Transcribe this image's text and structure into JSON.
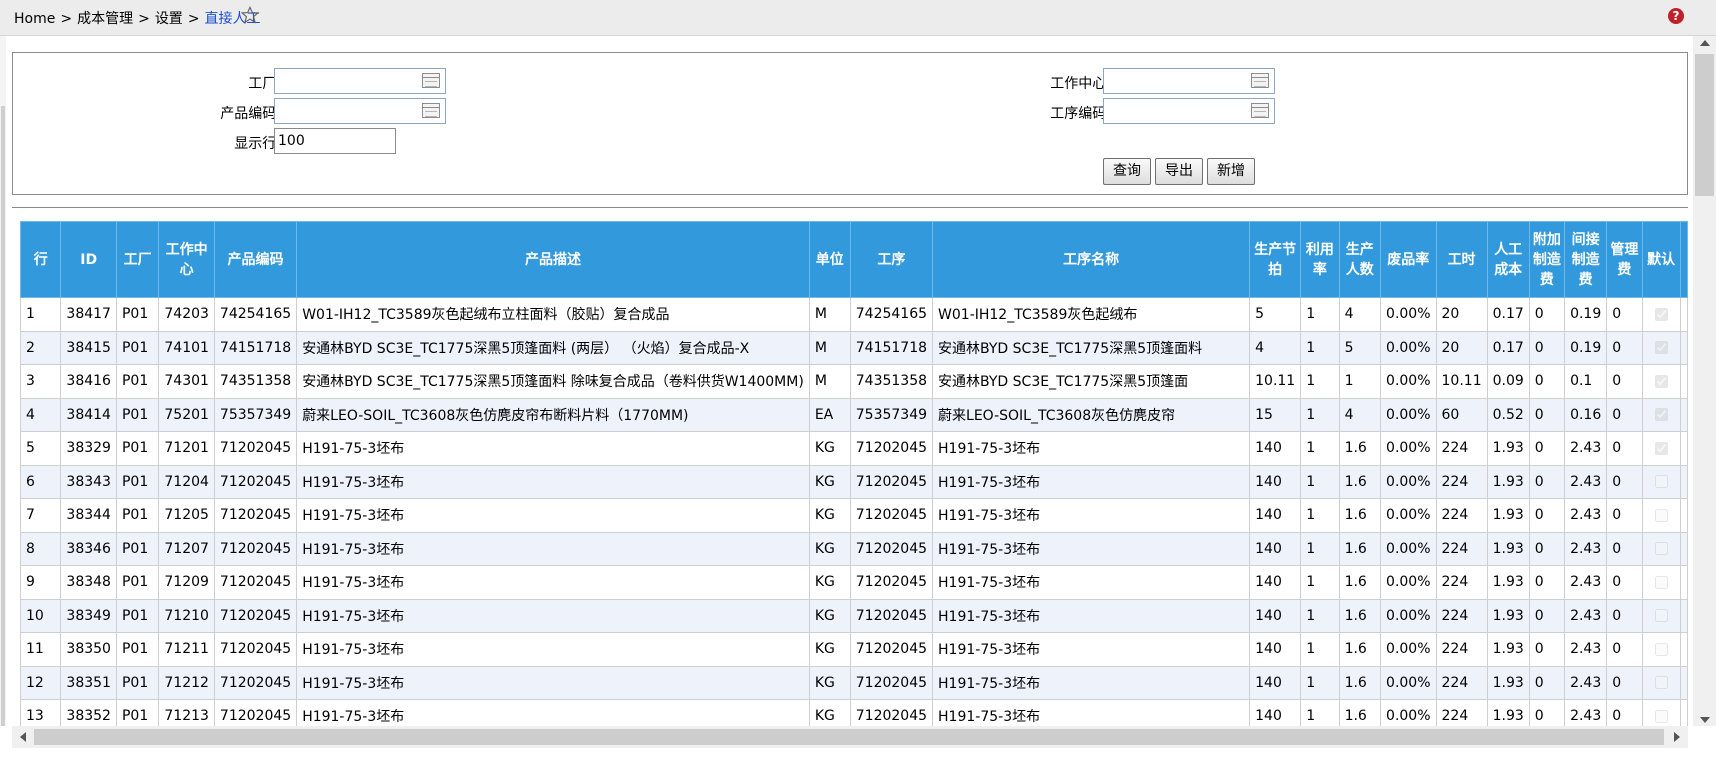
{
  "breadcrumb": {
    "home": "Home",
    "sep": ">",
    "level1": "成本管理",
    "level2": "设置",
    "current": "直接人工"
  },
  "icons": {
    "star": "star-outline-icon",
    "help": "help-icon",
    "picker": "table-picker-icon"
  },
  "help_glyph": "?",
  "filters": {
    "plant_label": "工厂:",
    "product_code_label": "产品编码:",
    "rows_label": "显示行:",
    "rows_value": "100",
    "work_center_label": "工作中心:",
    "process_code_label": "工序编码:",
    "plant_value": "",
    "product_code_value": "",
    "work_center_value": "",
    "process_code_value": ""
  },
  "buttons": {
    "query": "查询",
    "export": "导出",
    "add": "新增"
  },
  "colors": {
    "header_bg": "#3399dd",
    "alt_row_bg": "#eef3fb",
    "link": "#1a4fd6"
  },
  "table": {
    "columns": [
      "行",
      "ID",
      "工厂",
      "工作中心",
      "产品编码",
      "产品描述",
      "单位",
      "工序",
      "工序名称",
      "生产节拍",
      "利用率",
      "生产人数",
      "废品率",
      "工时",
      "人工成本",
      "附加制造费",
      "间接制造费",
      "管理费",
      "默认"
    ],
    "rows": [
      {
        "row": "1",
        "id": "38417",
        "plant": "P01",
        "wc": "74203",
        "code": "74254165",
        "desc": "W01-IH12_TC3589灰色起绒布立柱面料（胶贴）复合成品",
        "unit": "M",
        "proc": "74254165",
        "pname": "W01-IH12_TC3589灰色起绒布",
        "takt": "5",
        "util": "1",
        "workers": "4",
        "scrap": "0.00%",
        "hours": "20",
        "labor": "0.17",
        "addl": "0",
        "indirect": "0.19",
        "mgmt": "0",
        "def": true
      },
      {
        "row": "2",
        "id": "38415",
        "plant": "P01",
        "wc": "74101",
        "code": "74151718",
        "desc": "安通林BYD SC3E_TC1775深黑5顶篷面料 (两层） （火焰）复合成品-X",
        "unit": "M",
        "proc": "74151718",
        "pname": "安通林BYD SC3E_TC1775深黑5顶篷面料",
        "takt": "4",
        "util": "1",
        "workers": "5",
        "scrap": "0.00%",
        "hours": "20",
        "labor": "0.17",
        "addl": "0",
        "indirect": "0.19",
        "mgmt": "0",
        "def": true
      },
      {
        "row": "3",
        "id": "38416",
        "plant": "P01",
        "wc": "74301",
        "code": "74351358",
        "desc": "安通林BYD SC3E_TC1775深黑5顶篷面料 除味复合成品（卷料供货W1400MM)",
        "unit": "M",
        "proc": "74351358",
        "pname": "安通林BYD SC3E_TC1775深黑5顶篷面",
        "takt": "10.11",
        "util": "1",
        "workers": "1",
        "scrap": "0.00%",
        "hours": "10.11",
        "labor": "0.09",
        "addl": "0",
        "indirect": "0.1",
        "mgmt": "0",
        "def": true
      },
      {
        "row": "4",
        "id": "38414",
        "plant": "P01",
        "wc": "75201",
        "code": "75357349",
        "desc": "蔚来LEO-SOIL_TC3608灰色仿麂皮帘布断料片料（1770MM)",
        "unit": "EA",
        "proc": "75357349",
        "pname": "蔚来LEO-SOIL_TC3608灰色仿麂皮帘",
        "takt": "15",
        "util": "1",
        "workers": "4",
        "scrap": "0.00%",
        "hours": "60",
        "labor": "0.52",
        "addl": "0",
        "indirect": "0.16",
        "mgmt": "0",
        "def": true
      },
      {
        "row": "5",
        "id": "38329",
        "plant": "P01",
        "wc": "71201",
        "code": "71202045",
        "desc": "H191-75-3坯布",
        "unit": "KG",
        "proc": "71202045",
        "pname": "H191-75-3坯布",
        "takt": "140",
        "util": "1",
        "workers": "1.6",
        "scrap": "0.00%",
        "hours": "224",
        "labor": "1.93",
        "addl": "0",
        "indirect": "2.43",
        "mgmt": "0",
        "def": true
      },
      {
        "row": "6",
        "id": "38343",
        "plant": "P01",
        "wc": "71204",
        "code": "71202045",
        "desc": "H191-75-3坯布",
        "unit": "KG",
        "proc": "71202045",
        "pname": "H191-75-3坯布",
        "takt": "140",
        "util": "1",
        "workers": "1.6",
        "scrap": "0.00%",
        "hours": "224",
        "labor": "1.93",
        "addl": "0",
        "indirect": "2.43",
        "mgmt": "0",
        "def": false
      },
      {
        "row": "7",
        "id": "38344",
        "plant": "P01",
        "wc": "71205",
        "code": "71202045",
        "desc": "H191-75-3坯布",
        "unit": "KG",
        "proc": "71202045",
        "pname": "H191-75-3坯布",
        "takt": "140",
        "util": "1",
        "workers": "1.6",
        "scrap": "0.00%",
        "hours": "224",
        "labor": "1.93",
        "addl": "0",
        "indirect": "2.43",
        "mgmt": "0",
        "def": false
      },
      {
        "row": "8",
        "id": "38346",
        "plant": "P01",
        "wc": "71207",
        "code": "71202045",
        "desc": "H191-75-3坯布",
        "unit": "KG",
        "proc": "71202045",
        "pname": "H191-75-3坯布",
        "takt": "140",
        "util": "1",
        "workers": "1.6",
        "scrap": "0.00%",
        "hours": "224",
        "labor": "1.93",
        "addl": "0",
        "indirect": "2.43",
        "mgmt": "0",
        "def": false
      },
      {
        "row": "9",
        "id": "38348",
        "plant": "P01",
        "wc": "71209",
        "code": "71202045",
        "desc": "H191-75-3坯布",
        "unit": "KG",
        "proc": "71202045",
        "pname": "H191-75-3坯布",
        "takt": "140",
        "util": "1",
        "workers": "1.6",
        "scrap": "0.00%",
        "hours": "224",
        "labor": "1.93",
        "addl": "0",
        "indirect": "2.43",
        "mgmt": "0",
        "def": false
      },
      {
        "row": "10",
        "id": "38349",
        "plant": "P01",
        "wc": "71210",
        "code": "71202045",
        "desc": "H191-75-3坯布",
        "unit": "KG",
        "proc": "71202045",
        "pname": "H191-75-3坯布",
        "takt": "140",
        "util": "1",
        "workers": "1.6",
        "scrap": "0.00%",
        "hours": "224",
        "labor": "1.93",
        "addl": "0",
        "indirect": "2.43",
        "mgmt": "0",
        "def": false
      },
      {
        "row": "11",
        "id": "38350",
        "plant": "P01",
        "wc": "71211",
        "code": "71202045",
        "desc": "H191-75-3坯布",
        "unit": "KG",
        "proc": "71202045",
        "pname": "H191-75-3坯布",
        "takt": "140",
        "util": "1",
        "workers": "1.6",
        "scrap": "0.00%",
        "hours": "224",
        "labor": "1.93",
        "addl": "0",
        "indirect": "2.43",
        "mgmt": "0",
        "def": false
      },
      {
        "row": "12",
        "id": "38351",
        "plant": "P01",
        "wc": "71212",
        "code": "71202045",
        "desc": "H191-75-3坯布",
        "unit": "KG",
        "proc": "71202045",
        "pname": "H191-75-3坯布",
        "takt": "140",
        "util": "1",
        "workers": "1.6",
        "scrap": "0.00%",
        "hours": "224",
        "labor": "1.93",
        "addl": "0",
        "indirect": "2.43",
        "mgmt": "0",
        "def": false
      },
      {
        "row": "13",
        "id": "38352",
        "plant": "P01",
        "wc": "71213",
        "code": "71202045",
        "desc": "H191-75-3坯布",
        "unit": "KG",
        "proc": "71202045",
        "pname": "H191-75-3坯布",
        "takt": "140",
        "util": "1",
        "workers": "1.6",
        "scrap": "0.00%",
        "hours": "224",
        "labor": "1.93",
        "addl": "0",
        "indirect": "2.43",
        "mgmt": "0",
        "def": false
      }
    ]
  }
}
